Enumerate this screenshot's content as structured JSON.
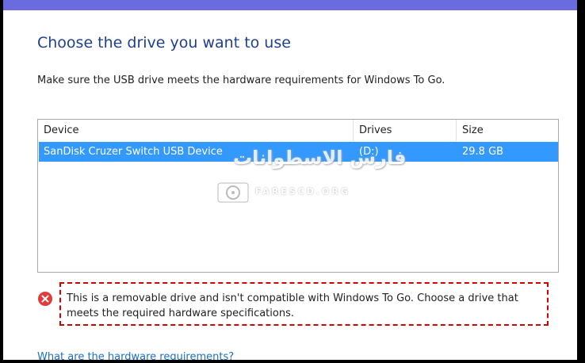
{
  "heading": "Choose the drive you want to use",
  "instructions": "Make sure the USB drive meets the hardware requirements for Windows To Go.",
  "table": {
    "columns": [
      "Device",
      "Drives",
      "Size"
    ],
    "rows": [
      {
        "device": "SanDisk Cruzer Switch USB Device",
        "drive": "(D:)",
        "size": "29.8 GB",
        "selected": true
      }
    ]
  },
  "error": {
    "message_line1": "This is a removable drive and isn't compatible with Windows To Go. Choose a drive that",
    "message_line2": "meets the required hardware specifications."
  },
  "link": "What are the hardware requirements?",
  "watermark": {
    "title": "فارس الاسطوانات",
    "site": "FARESCD.ORG"
  },
  "colors": {
    "title_band": "#6b6be0",
    "heading": "#1f3f8f",
    "selection": "#3399ff",
    "error_icon": "#e03c3c",
    "error_border": "#d40000",
    "link": "#1c6fc2"
  }
}
